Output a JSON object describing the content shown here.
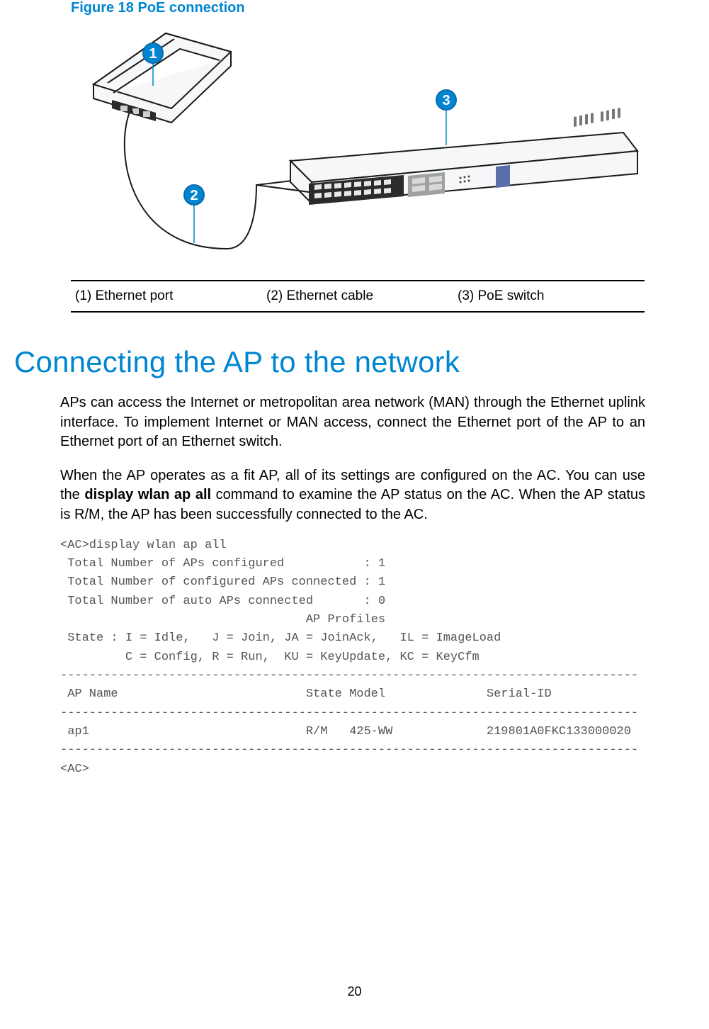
{
  "figure": {
    "title": "Figure 18 PoE connection",
    "callouts": {
      "a": "1",
      "b": "2",
      "c": "3"
    }
  },
  "legend": {
    "a": "(1) Ethernet port",
    "b": "(2) Ethernet cable",
    "c": "(3) PoE switch"
  },
  "section": {
    "heading": "Connecting the AP to the network",
    "para1": "APs can access the Internet or metropolitan area network (MAN) through the Ethernet uplink interface. To implement Internet or MAN access, connect the Ethernet port of the AP to an Ethernet port of an Ethernet switch.",
    "para2a": "When the AP operates as a fit AP, all of its settings are configured on the AC. You can use the ",
    "para2b": "display wlan ap all",
    "para2c": " command to examine the AP status on the AC. When the AP status is R/M, the AP has been successfully connected to the AC."
  },
  "code": "<AC>display wlan ap all\n Total Number of APs configured           : 1\n Total Number of configured APs connected : 1\n Total Number of auto APs connected       : 0\n                                  AP Profiles\n State : I = Idle,   J = Join, JA = JoinAck,   IL = ImageLoad\n         C = Config, R = Run,  KU = KeyUpdate, KC = KeyCfm\n--------------------------------------------------------------------------------\n AP Name                          State Model              Serial-ID\n--------------------------------------------------------------------------------\n ap1                              R/M   425-WW             219801A0FKC133000020\n--------------------------------------------------------------------------------\n<AC>",
  "page_number": "20"
}
